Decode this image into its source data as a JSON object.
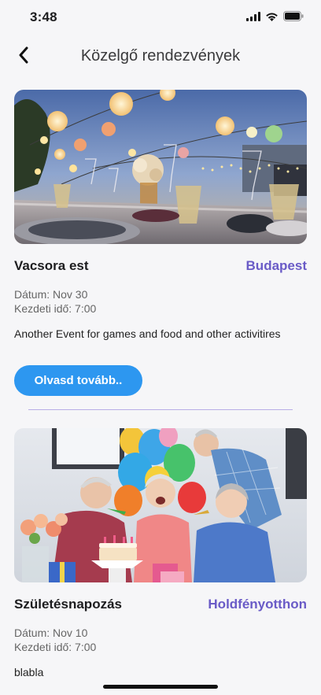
{
  "status": {
    "time": "3:48"
  },
  "header": {
    "title": "Közelgő rendezvények"
  },
  "events": [
    {
      "title": "Vacsora est",
      "location": "Budapest",
      "date_label": "Dátum: Nov 30",
      "time_label": "Kezdeti idő: 7:00",
      "description": "Another Event for games and food and other activitires",
      "button_label": "Olvasd tovább.."
    },
    {
      "title": "Születésnapozás",
      "location": "Holdfényotthon",
      "date_label": "Dátum: Nov 10",
      "time_label": "Kezdeti idő: 7:00",
      "description": "blabla"
    }
  ],
  "colors": {
    "accent": "#6a5bc7",
    "button": "#2d97f0",
    "divider": "#b8aee6"
  }
}
